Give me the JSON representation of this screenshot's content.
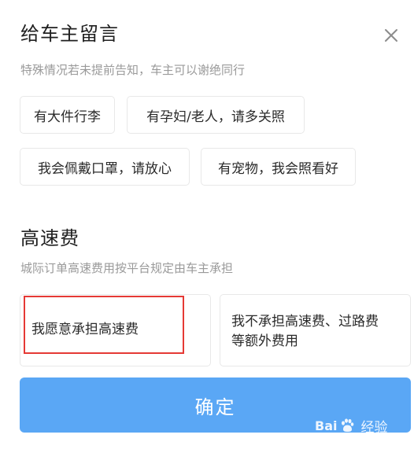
{
  "dialog": {
    "title": "给车主留言",
    "close_icon": "close-icon",
    "subtitle": "特殊情况若未提前告知，车主可以谢绝同行"
  },
  "message_chips": [
    {
      "label": "有大件行李"
    },
    {
      "label": "有孕妇/老人，请多关照"
    },
    {
      "label": "我会佩戴口罩，请放心"
    },
    {
      "label": "有宠物，我会照看好"
    }
  ],
  "toll": {
    "title": "高速费",
    "subtitle": "城际订单高速费用按平台规定由车主承担",
    "options": [
      {
        "line1": "我愿意承担高速费",
        "line2": ""
      },
      {
        "line1": "我不承担高速费、过路费",
        "line2": "等额外费用"
      }
    ]
  },
  "confirm_label": "确定",
  "watermark": {
    "brand_left": "Bai",
    "brand_right": "",
    "suffix": "经验",
    "icon": "baidu-paw-icon"
  },
  "colors": {
    "primary_button": "#5aa7f5",
    "highlight_box": "#e53935",
    "chip_border": "#e8e8e8",
    "muted_text": "#9a9a9a"
  }
}
